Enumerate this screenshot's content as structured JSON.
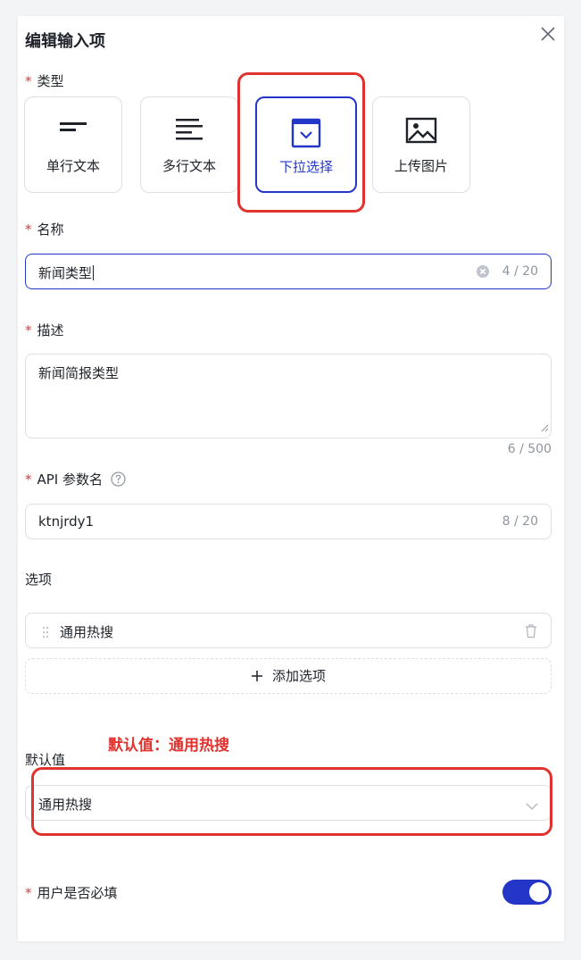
{
  "dialog": {
    "title": "编辑输入项"
  },
  "required_mark": "*",
  "type": {
    "label": "类型",
    "options": [
      {
        "label": "单行文本",
        "icon": "single-line-icon"
      },
      {
        "label": "多行文本",
        "icon": "multi-line-icon"
      },
      {
        "label": "下拉选择",
        "icon": "dropdown-select-icon"
      },
      {
        "label": "上传图片",
        "icon": "image-upload-icon"
      }
    ],
    "selected": "下拉选择"
  },
  "name": {
    "label": "名称",
    "value": "新闻类型",
    "counter": "4 / 20"
  },
  "description": {
    "label": "描述",
    "value": "新闻简报类型",
    "counter": "6 / 500"
  },
  "api_param": {
    "label": "API 参数名",
    "value": "ktnjrdy1",
    "counter": "8 / 20"
  },
  "options": {
    "label": "选项",
    "items": [
      {
        "label": "通用热搜"
      }
    ],
    "add_label": "添加选项"
  },
  "annotation": {
    "text": "默认值：通用热搜"
  },
  "default_value": {
    "label": "默认值",
    "value": "通用热搜"
  },
  "required_toggle": {
    "label": "用户是否必填",
    "on": true
  },
  "colors": {
    "accent": "#2436c8",
    "highlight_red": "#e0322e",
    "required_red": "#e03a3a"
  }
}
